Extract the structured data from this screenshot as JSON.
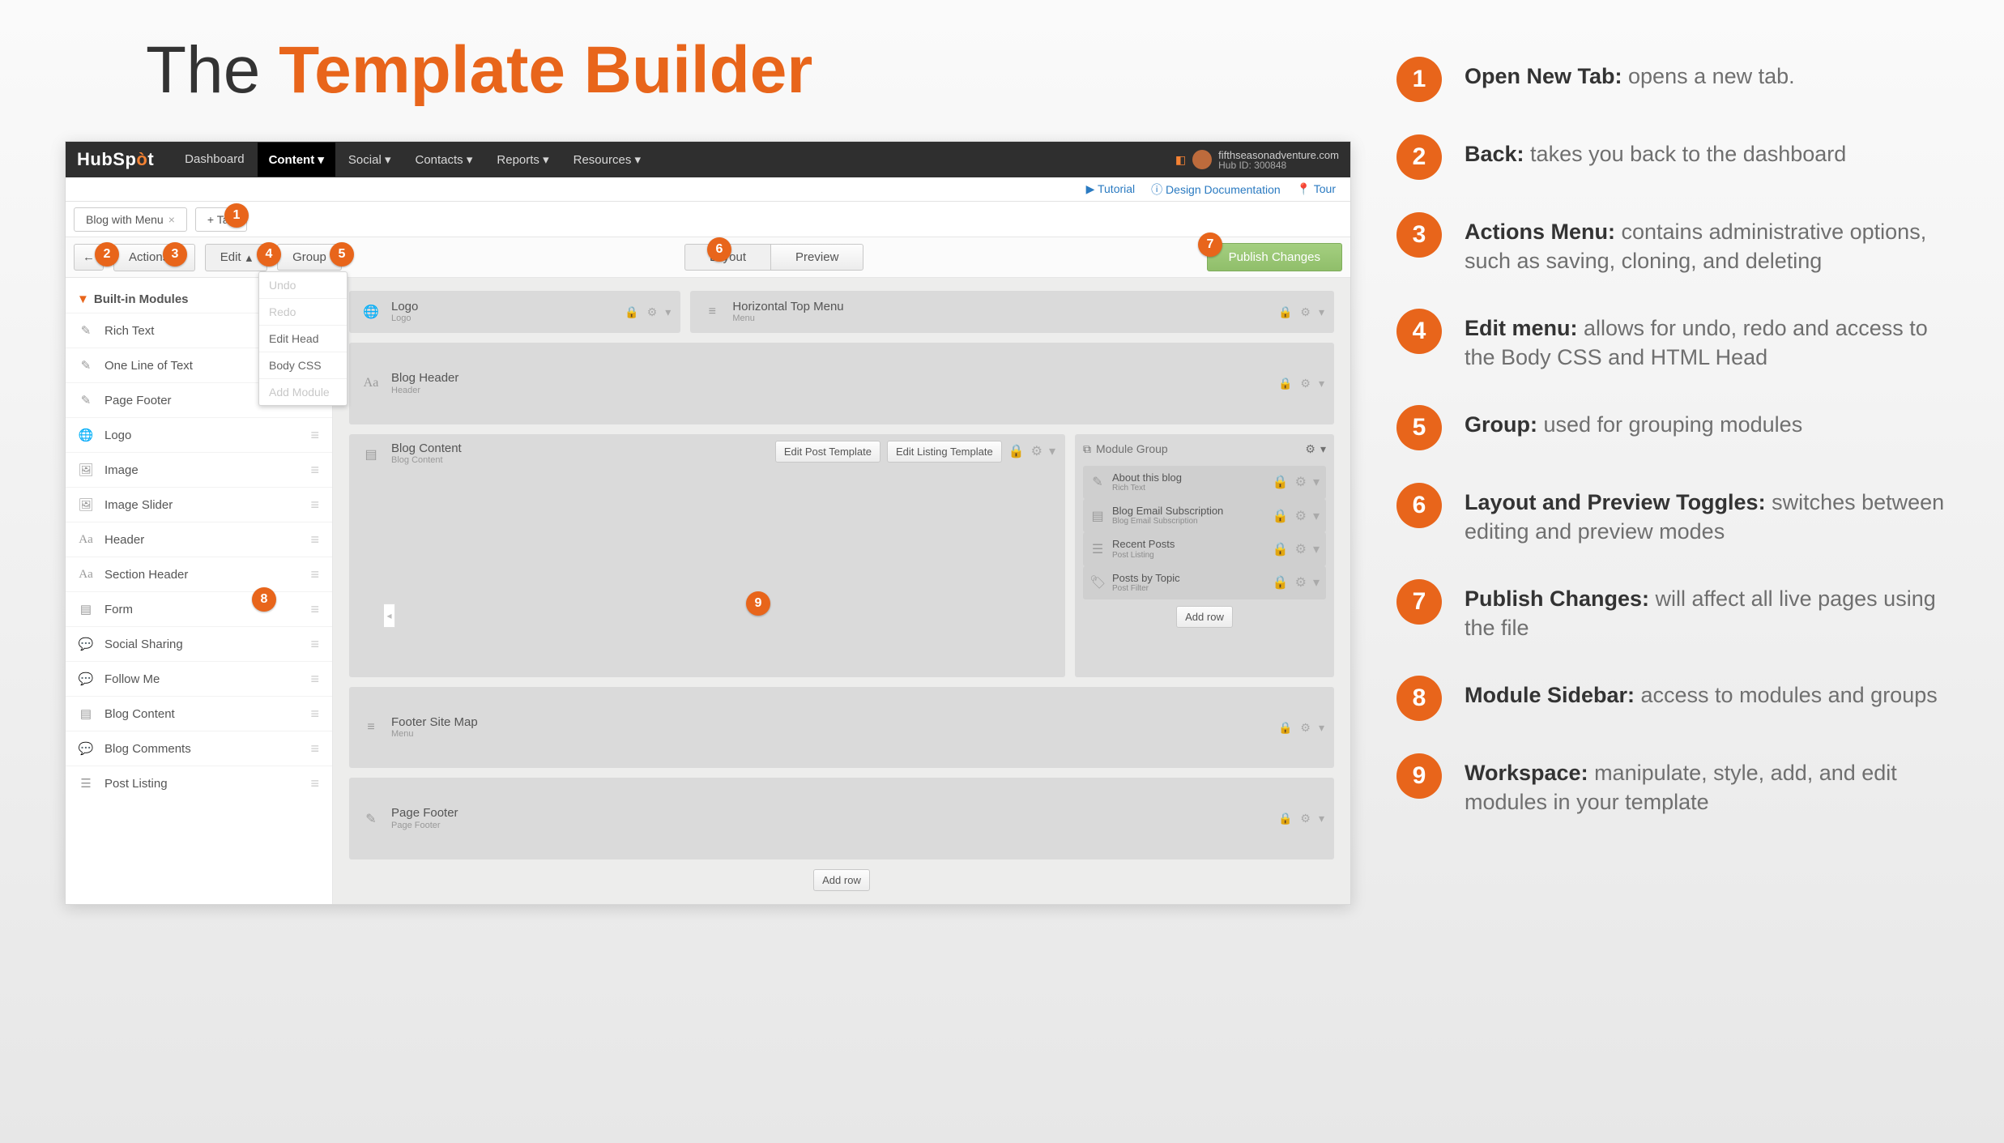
{
  "slide": {
    "title_prefix": "The ",
    "title_emph": "Template Builder"
  },
  "annotations": [
    {
      "num": "1",
      "title": "Open New Tab:",
      "desc": " opens a new tab."
    },
    {
      "num": "2",
      "title": "Back:",
      "desc": " takes you back to the dashboard"
    },
    {
      "num": "3",
      "title": "Actions Menu:",
      "desc": " contains administrative options, such as saving, cloning, and deleting"
    },
    {
      "num": "4",
      "title": "Edit menu:",
      "desc": " allows  for undo, redo and access to the Body CSS and HTML Head"
    },
    {
      "num": "5",
      "title": "Group:",
      "desc": " used for grouping modules"
    },
    {
      "num": "6",
      "title": "Layout and Preview Toggles:",
      "desc": " switches between editing and preview modes"
    },
    {
      "num": "7",
      "title": "Publish Changes:",
      "desc": " will affect all live pages using the file"
    },
    {
      "num": "8",
      "title": "Module Sidebar:",
      "desc": " access to modules and groups"
    },
    {
      "num": "9",
      "title": "Workspace:",
      "desc": " manipulate, style, add, and edit modules in your template"
    }
  ],
  "brand": {
    "name_l": "HubSp",
    "name_r": "t",
    "orange": "ò"
  },
  "topnav": [
    "Dashboard",
    "Content",
    "Social",
    "Contacts",
    "Reports",
    "Resources"
  ],
  "account": {
    "line1": "fifthseasonadventure.com",
    "line2": "Hub ID: 300848"
  },
  "helpbar": {
    "tutorial": "Tutorial",
    "docs": "Design Documentation",
    "tour": "Tour"
  },
  "tabs": {
    "file": "Blog with Menu",
    "add": "+ Tab"
  },
  "toolbar": {
    "back": "←",
    "actions": "Actions",
    "edit": "Edit",
    "group": "Group",
    "layout": "Layout",
    "preview": "Preview",
    "publish": "Publish Changes"
  },
  "edit_menu": [
    "Undo",
    "Redo",
    "Edit Head",
    "Body CSS",
    "Add Module"
  ],
  "sidebar": {
    "header": "Built-in Modules",
    "items": [
      {
        "icon": "edit",
        "label": "Rich Text"
      },
      {
        "icon": "edit",
        "label": "One Line of Text"
      },
      {
        "icon": "edit",
        "label": "Page Footer"
      },
      {
        "icon": "globe",
        "label": "Logo"
      },
      {
        "icon": "image",
        "label": "Image"
      },
      {
        "icon": "image",
        "label": "Image Slider"
      },
      {
        "icon": "aa",
        "label": "Header"
      },
      {
        "icon": "aa",
        "label": "Section Header"
      },
      {
        "icon": "form",
        "label": "Form"
      },
      {
        "icon": "chat",
        "label": "Social Sharing"
      },
      {
        "icon": "chat",
        "label": "Follow Me"
      },
      {
        "icon": "doc",
        "label": "Blog Content"
      },
      {
        "icon": "chat",
        "label": "Blog Comments"
      },
      {
        "icon": "list",
        "label": "Post Listing"
      }
    ]
  },
  "canvas": {
    "row1": [
      {
        "icon": "globe",
        "t1": "Logo",
        "t2": "Logo"
      },
      {
        "icon": "lines",
        "t1": "Horizontal Top Menu",
        "t2": "Menu"
      }
    ],
    "row2": {
      "icon": "aa",
      "t1": "Blog Header",
      "t2": "Header"
    },
    "blog": {
      "icon": "doc",
      "t1": "Blog Content",
      "t2": "Blog Content",
      "editPost": "Edit Post Template",
      "editListing": "Edit Listing Template"
    },
    "group": {
      "head": "Module Group",
      "items": [
        {
          "icon": "edit",
          "t1": "About this blog",
          "t2": "Rich Text"
        },
        {
          "icon": "form",
          "t1": "Blog Email Subscription",
          "t2": "Blog Email Subscription"
        },
        {
          "icon": "list",
          "t1": "Recent Posts",
          "t2": "Post Listing"
        },
        {
          "icon": "tag",
          "t1": "Posts by Topic",
          "t2": "Post Filter"
        }
      ],
      "addrow": "Add row"
    },
    "footer": {
      "icon": "lines",
      "t1": "Footer Site Map",
      "t2": "Menu"
    },
    "pagefooter": {
      "icon": "edit",
      "t1": "Page Footer",
      "t2": "Page Footer"
    },
    "addrow": "Add row"
  },
  "badges_inner": [
    "1",
    "2",
    "3",
    "4",
    "5",
    "6",
    "7",
    "8",
    "9"
  ]
}
